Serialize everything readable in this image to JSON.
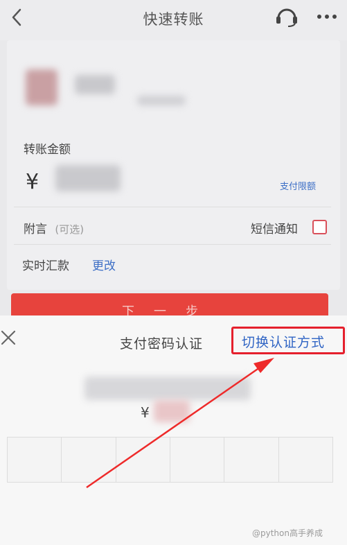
{
  "nav": {
    "title": "快速转账",
    "back_icon": "chevron-left-icon",
    "headset_icon": "headset-icon",
    "more_icon": "more-dots-icon"
  },
  "form": {
    "amount_label": "转账金额",
    "currency_symbol": "¥",
    "limit_link": "支付限额",
    "remark_label": "附言",
    "remark_hint": "(可选)",
    "sms_label": "短信通知",
    "realtime_label": "实时汇款",
    "change_link": "更改"
  },
  "next_button": {
    "label": "下一步"
  },
  "sheet": {
    "title": "支付密码认证",
    "switch_label": "切换认证方式",
    "currency_symbol": "¥",
    "pin_cells": [
      "",
      "",
      "",
      "",
      "",
      ""
    ]
  },
  "watermark": "@python高手养成",
  "colors": {
    "accent_red": "#e7433d",
    "link_blue": "#3d6fc6",
    "highlight_border": "#e5202d",
    "arrow": "#ee2a2a"
  }
}
